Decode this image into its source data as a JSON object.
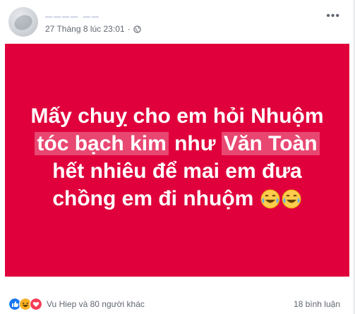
{
  "post": {
    "timestamp": "27 Tháng 8 lúc 23:01",
    "banner_color": "#e0003c",
    "lines": [
      {
        "text": "Mấy chuỵ cho em hỏi Nhuộm"
      },
      {
        "pre": "",
        "hl1": "tóc bạch kim",
        "mid": " như ",
        "hl2": "Văn Toàn",
        "post": ""
      },
      {
        "text": "hết nhiêu để mai em đưa"
      },
      {
        "text": "chồng em đi nhuộm"
      }
    ],
    "emoji": "laughing-crying-emoji"
  },
  "reactions": {
    "icons": [
      "like-icon",
      "haha-icon",
      "love-icon"
    ],
    "text": "Vu Hiep và 80 người khác"
  },
  "comments": {
    "text": "18 bình luận"
  }
}
